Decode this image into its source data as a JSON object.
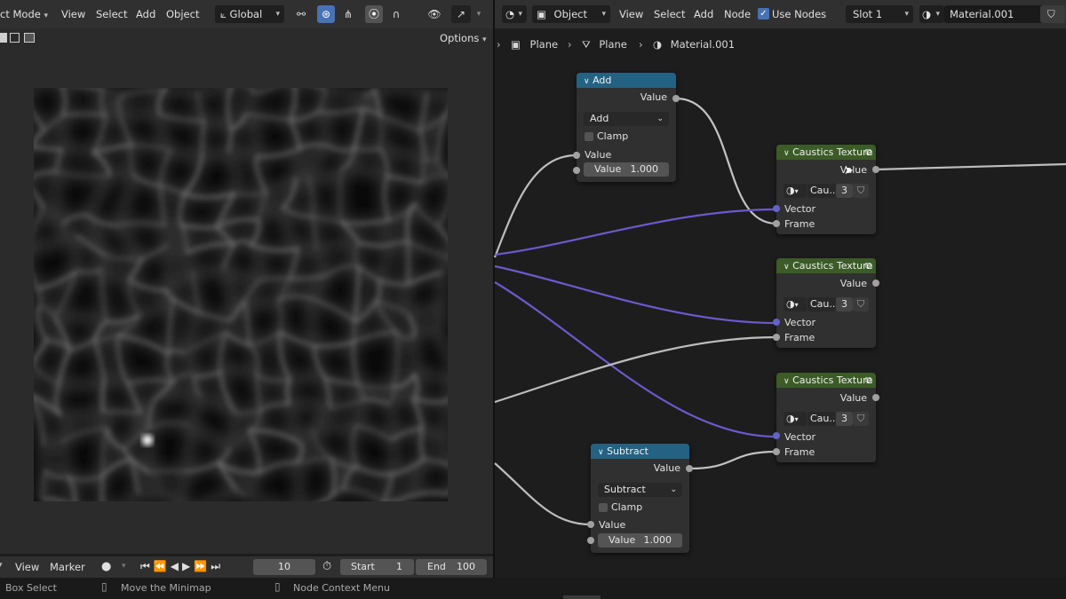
{
  "left_header": {
    "mode": "ct Mode",
    "menus": [
      "View",
      "Select",
      "Add",
      "Object"
    ],
    "transform": "Global",
    "options": "Options"
  },
  "right_header": {
    "object_mode": "Object",
    "menus": [
      "View",
      "Select",
      "Add",
      "Node"
    ],
    "use_nodes": "Use Nodes",
    "slot": "Slot 1",
    "material": "Material.001"
  },
  "breadcrumb": [
    "Plane",
    "Plane",
    "Material.001"
  ],
  "timeline": {
    "menus": [
      "View",
      "Marker"
    ],
    "current_frame": "10",
    "start_label": "Start",
    "start": "1",
    "end_label": "End",
    "end": "100"
  },
  "status": {
    "box_select": "Box Select",
    "minimap": "Move the Minimap",
    "context": "Node Context Menu"
  },
  "nodes": {
    "add": {
      "title": "Add",
      "out": "Value",
      "op": "Add",
      "clamp": "Clamp",
      "in1": "Value",
      "in2_label": "Value",
      "in2_val": "1.000"
    },
    "subtract": {
      "title": "Subtract",
      "out": "Value",
      "op": "Subtract",
      "clamp": "Clamp",
      "in1": "Value",
      "in2_label": "Value",
      "in2_val": "1.000"
    },
    "caustics": [
      {
        "title": "Caustics Texture",
        "out": "Value",
        "group": "Cau...",
        "users": "3",
        "vector": "Vector",
        "frame": "Frame"
      },
      {
        "title": "Caustics Texture",
        "out": "Value",
        "group": "Cau...",
        "users": "3",
        "vector": "Vector",
        "frame": "Frame"
      },
      {
        "title": "Caustics Texture",
        "out": "Value",
        "group": "Cau...",
        "users": "3",
        "vector": "Vector",
        "frame": "Frame"
      }
    ]
  },
  "colors": {
    "math_header": "#246283",
    "group_header": "#3b5b27",
    "vector_socket": "#6363c7",
    "float_socket": "#a1a1a1",
    "accent": "#4772b3"
  }
}
